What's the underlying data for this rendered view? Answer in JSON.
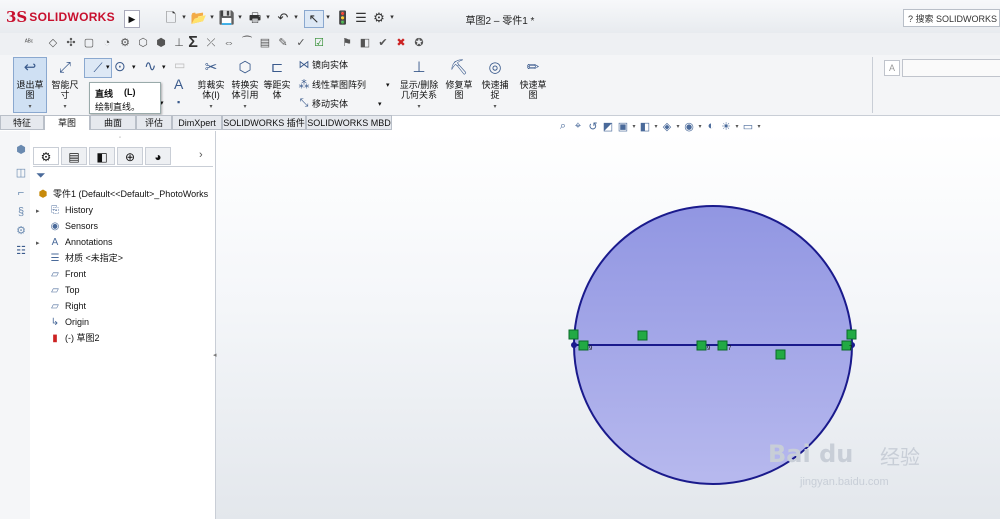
{
  "titlebar": {
    "logo_ds": "3S",
    "logo_text": "SOLIDWORKS",
    "document_title": "草图2 – 零件1 *",
    "search_placeholder": "搜索 SOLIDWORKS 帮"
  },
  "command_manager": {
    "exit_sketch": "退出草图",
    "smart_dim_1": "智能尺",
    "smart_dim_2": "寸",
    "trim_1": "剪裁实",
    "trim_2": "体(I)",
    "convert_1": "转换实",
    "convert_2": "体引用",
    "offset_1": "等距实",
    "offset_2": "体",
    "mirror": "镜向实体",
    "linear_pattern": "线性草图阵列",
    "move": "移动实体",
    "show_relations_1": "显示/删除",
    "show_relations_2": "几何关系",
    "repair_1": "修复草",
    "repair_2": "图",
    "quick_snap_1": "快速捕",
    "quick_snap_2": "捉",
    "rapid_sketch_1": "快速草",
    "rapid_sketch_2": "图"
  },
  "tooltip": {
    "title": "直线",
    "shortcut": "(L)",
    "description": "绘制直线。"
  },
  "tabs": [
    "特征",
    "草图",
    "曲面",
    "评估",
    "DimXpert",
    "SOLIDWORKS 插件",
    "SOLIDWORKS MBD"
  ],
  "active_tab": "草图",
  "tree": {
    "root": "零件1  (Default<<Default>_PhotoWorks",
    "items": [
      "History",
      "Sensors",
      "Annotations",
      "材质 <未指定>",
      "Front",
      "Top",
      "Right",
      "Origin",
      "(-) 草图2"
    ]
  },
  "sketch": {
    "circle_fill": "#9ba0e6",
    "circle_stroke": "#1a1a8c",
    "relation_color": "#22aa44"
  },
  "watermark": {
    "brand": "Bai  du",
    "cn": "经验",
    "url": "jingyan.baidu.com"
  }
}
